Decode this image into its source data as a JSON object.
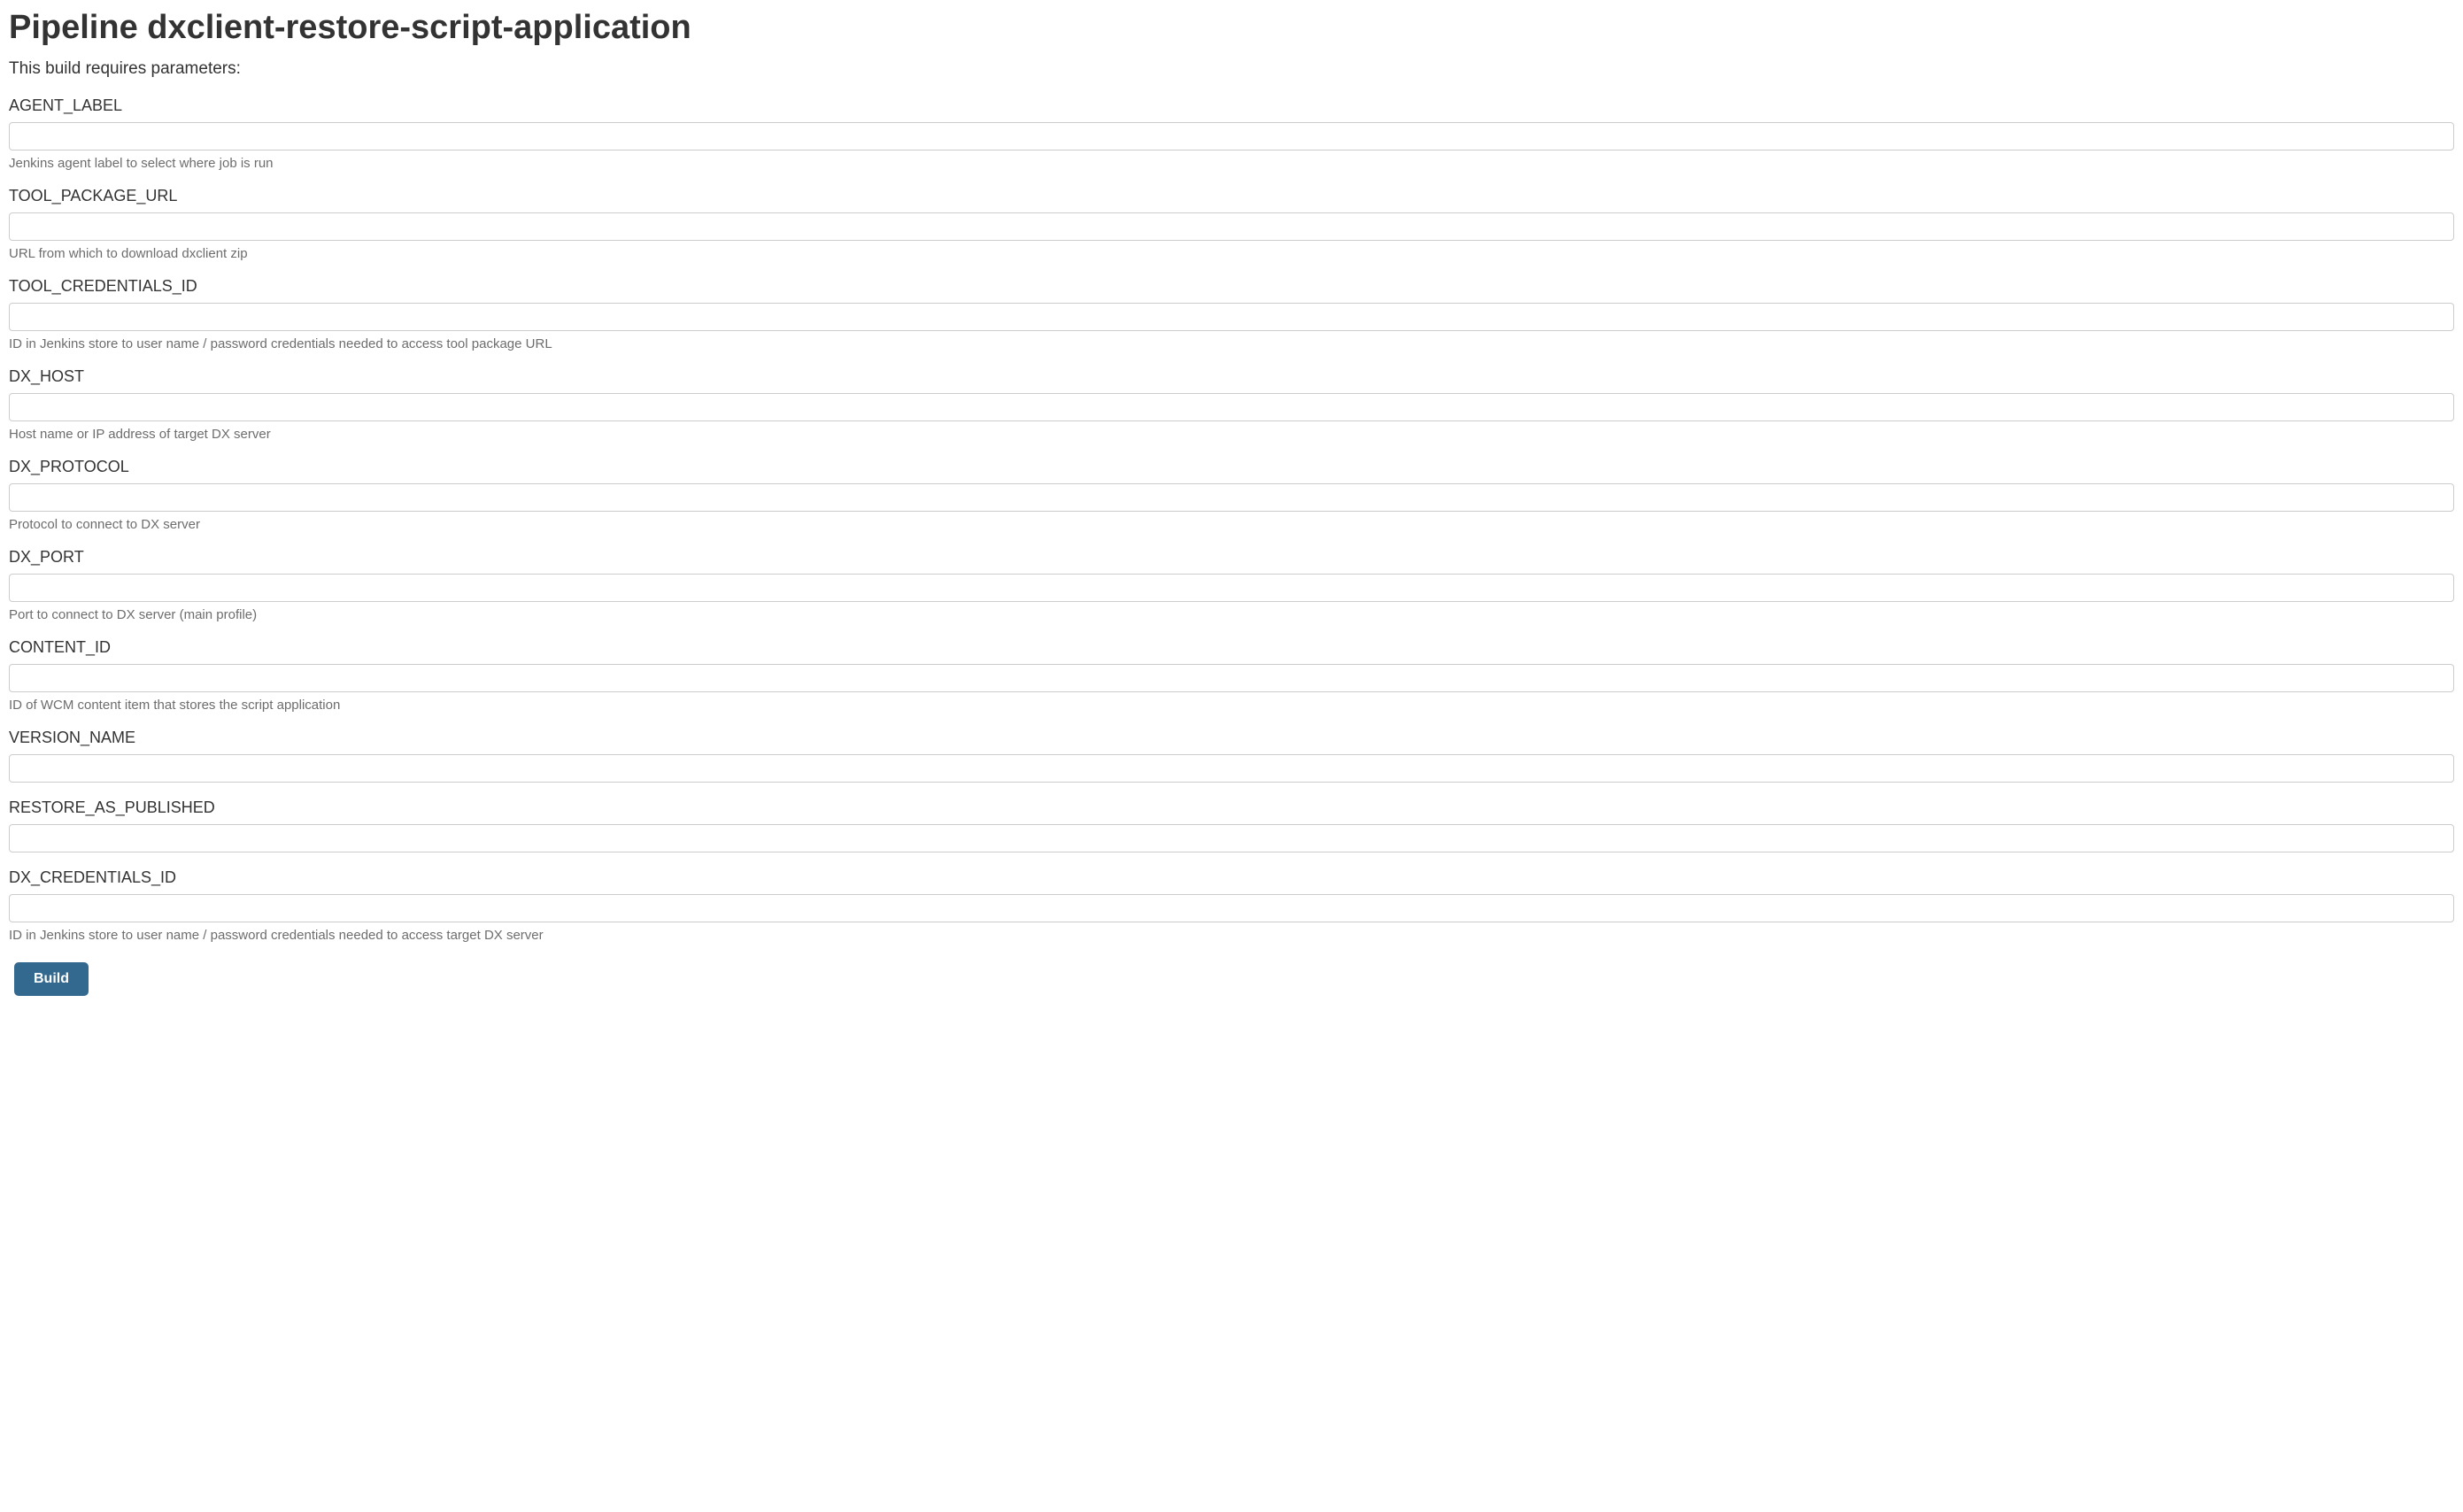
{
  "page": {
    "title": "Pipeline dxclient-restore-script-application",
    "subtitle": "This build requires parameters:"
  },
  "params": {
    "agent_label": {
      "label": "AGENT_LABEL",
      "value": "",
      "help": "Jenkins agent label to select where job is run"
    },
    "tool_package_url": {
      "label": "TOOL_PACKAGE_URL",
      "value": "",
      "help": "URL from which to download dxclient zip"
    },
    "tool_credentials_id": {
      "label": "TOOL_CREDENTIALS_ID",
      "value": "",
      "help": "ID in Jenkins store to user name / password credentials needed to access tool package URL"
    },
    "dx_host": {
      "label": "DX_HOST",
      "value": "",
      "help": "Host name or IP address of target DX server"
    },
    "dx_protocol": {
      "label": "DX_PROTOCOL",
      "value": "",
      "help": "Protocol to connect to DX server"
    },
    "dx_port": {
      "label": "DX_PORT",
      "value": "",
      "help": "Port to connect to DX server (main profile)"
    },
    "content_id": {
      "label": "CONTENT_ID",
      "value": "",
      "help": "ID of WCM content item that stores the script application"
    },
    "version_name": {
      "label": "VERSION_NAME",
      "value": "",
      "help": ""
    },
    "restore_as_published": {
      "label": "RESTORE_AS_PUBLISHED",
      "value": "",
      "help": ""
    },
    "dx_credentials_id": {
      "label": "DX_CREDENTIALS_ID",
      "value": "",
      "help": "ID in Jenkins store to user name / password credentials needed to access target DX server"
    }
  },
  "actions": {
    "build_label": "Build"
  }
}
